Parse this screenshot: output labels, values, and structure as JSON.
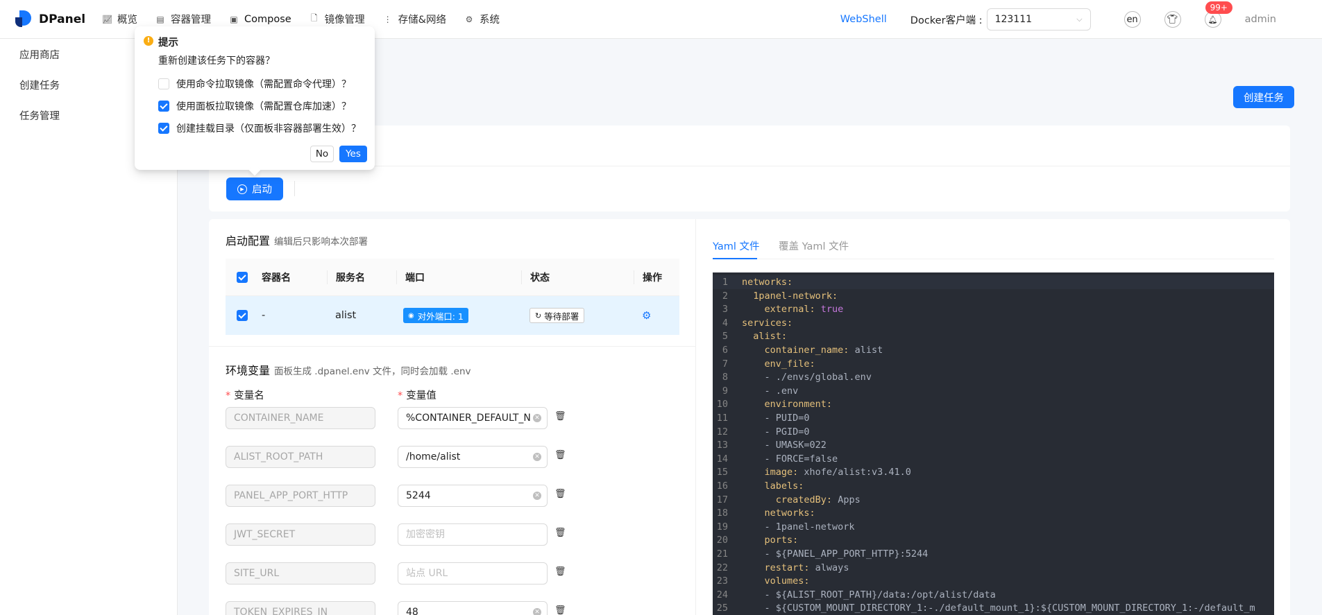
{
  "app": {
    "name": "DPanel"
  },
  "nav": [
    {
      "label": "概览",
      "icon": "chart-icon"
    },
    {
      "label": "容器管理",
      "icon": "container-icon"
    },
    {
      "label": "Compose",
      "icon": "compose-icon"
    },
    {
      "label": "镜像管理",
      "icon": "file-icon"
    },
    {
      "label": "存储&网络",
      "icon": "more-icon"
    },
    {
      "label": "系统",
      "icon": "gear-icon"
    }
  ],
  "top_right": {
    "webshell": "WebShell",
    "docker_label": "Docker客户端 :",
    "docker_value": "123111",
    "lang": "en",
    "notifications": "99+",
    "user": "admin"
  },
  "sidebar": [
    {
      "label": "应用商店"
    },
    {
      "label": "创建任务"
    },
    {
      "label": "任务管理"
    }
  ],
  "main": {
    "create_button": "创建任务",
    "start_button": "启动"
  },
  "startup_config": {
    "title": "启动配置",
    "subtitle": "编辑后只影响本次部署",
    "columns": [
      "容器名",
      "服务名",
      "端口",
      "状态",
      "操作"
    ],
    "rows": [
      {
        "checked": true,
        "container_name": "-",
        "service_name": "alist",
        "port": "对外端口: 1",
        "status": "等待部署"
      }
    ]
  },
  "env": {
    "title": "环境变量",
    "subtitle": "面板生成 .dpanel.env 文件，同时会加载 .env",
    "name_label": "变量名",
    "value_label": "变量值",
    "rows": [
      {
        "name": "CONTAINER_NAME",
        "value": "%CONTAINER_DEFAULT_N",
        "placeholder": false
      },
      {
        "name": "ALIST_ROOT_PATH",
        "value": "/home/alist",
        "placeholder": false
      },
      {
        "name": "PANEL_APP_PORT_HTTP",
        "value": "5244",
        "placeholder": false
      },
      {
        "name": "JWT_SECRET",
        "value": "加密密钥",
        "placeholder": true
      },
      {
        "name": "SITE_URL",
        "value": "站点 URL",
        "placeholder": true
      },
      {
        "name": "TOKEN_EXPIRES_IN",
        "value": "48",
        "placeholder": false
      }
    ]
  },
  "yaml": {
    "tabs": [
      "Yaml 文件",
      "覆盖 Yaml 文件"
    ],
    "lines": [
      {
        "n": "1",
        "indent": "",
        "key": "networks:",
        "val": "",
        "bool": ""
      },
      {
        "n": "2",
        "indent": "  ",
        "key": "1panel-network:",
        "val": "",
        "bool": ""
      },
      {
        "n": "3",
        "indent": "    ",
        "key": "external:",
        "val": "",
        "bool": " true"
      },
      {
        "n": "4",
        "indent": "",
        "key": "services:",
        "val": "",
        "bool": ""
      },
      {
        "n": "5",
        "indent": "  ",
        "key": "alist:",
        "val": "",
        "bool": ""
      },
      {
        "n": "6",
        "indent": "    ",
        "key": "container_name:",
        "val": " alist",
        "bool": ""
      },
      {
        "n": "7",
        "indent": "    ",
        "key": "env_file:",
        "val": "",
        "bool": ""
      },
      {
        "n": "8",
        "indent": "    ",
        "key": "",
        "val": "- ./envs/global.env",
        "bool": ""
      },
      {
        "n": "9",
        "indent": "    ",
        "key": "",
        "val": "- .env",
        "bool": ""
      },
      {
        "n": "10",
        "indent": "    ",
        "key": "environment:",
        "val": "",
        "bool": ""
      },
      {
        "n": "11",
        "indent": "    ",
        "key": "",
        "val": "- PUID=0",
        "bool": ""
      },
      {
        "n": "12",
        "indent": "    ",
        "key": "",
        "val": "- PGID=0",
        "bool": ""
      },
      {
        "n": "13",
        "indent": "    ",
        "key": "",
        "val": "- UMASK=022",
        "bool": ""
      },
      {
        "n": "14",
        "indent": "    ",
        "key": "",
        "val": "- FORCE=false",
        "bool": ""
      },
      {
        "n": "15",
        "indent": "    ",
        "key": "image:",
        "val": " xhofe/alist:v3.41.0",
        "bool": ""
      },
      {
        "n": "16",
        "indent": "    ",
        "key": "labels:",
        "val": "",
        "bool": ""
      },
      {
        "n": "17",
        "indent": "      ",
        "key": "createdBy:",
        "val": " Apps",
        "bool": ""
      },
      {
        "n": "18",
        "indent": "    ",
        "key": "networks:",
        "val": "",
        "bool": ""
      },
      {
        "n": "19",
        "indent": "    ",
        "key": "",
        "val": "- 1panel-network",
        "bool": ""
      },
      {
        "n": "20",
        "indent": "    ",
        "key": "ports:",
        "val": "",
        "bool": ""
      },
      {
        "n": "21",
        "indent": "    ",
        "key": "",
        "val": "- ${PANEL_APP_PORT_HTTP}:5244",
        "bool": ""
      },
      {
        "n": "22",
        "indent": "    ",
        "key": "restart:",
        "val": " always",
        "bool": ""
      },
      {
        "n": "23",
        "indent": "    ",
        "key": "volumes:",
        "val": "",
        "bool": ""
      },
      {
        "n": "24",
        "indent": "    ",
        "key": "",
        "val": "- ${ALIST_ROOT_PATH}/data:/opt/alist/data",
        "bool": ""
      },
      {
        "n": "25",
        "indent": "    ",
        "key": "",
        "val": "- ${CUSTOM_MOUNT_DIRECTORY_1:-./default_mount_1}:${CUSTOM_MOUNT_DIRECTORY_1:-/default_m",
        "bool": ""
      }
    ]
  },
  "popconfirm": {
    "title": "提示",
    "message": "重新创建该任务下的容器？",
    "options": [
      {
        "label": "使用命令拉取镜像（需配置命令代理）？",
        "checked": false
      },
      {
        "label": "使用面板拉取镜像（需配置仓库加速）？",
        "checked": true
      },
      {
        "label": "创建挂载目录（仅面板非容器部署生效）？",
        "checked": true
      }
    ],
    "no": "No",
    "yes": "Yes"
  }
}
